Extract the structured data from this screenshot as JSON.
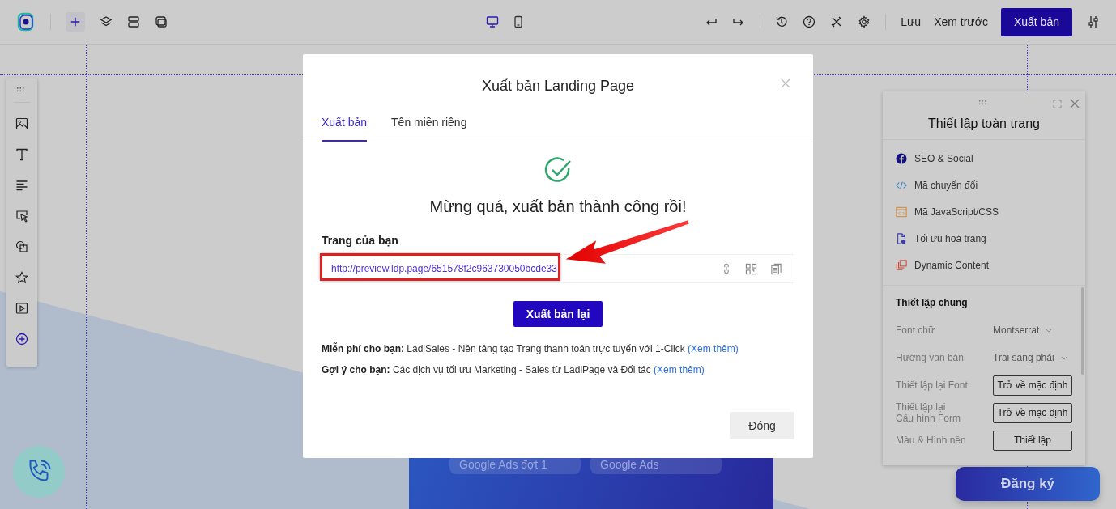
{
  "topbar": {
    "devices": [
      {
        "kind": "desktop",
        "selected": true
      },
      {
        "kind": "mobile",
        "selected": false
      }
    ],
    "links": [
      "Lưu",
      "Xem trước"
    ],
    "publish_button": "Xuất bản"
  },
  "canvas": {
    "form_fields": [
      {
        "placeholder": "Google Ads đợt 1"
      },
      {
        "placeholder": "Google Ads"
      }
    ],
    "cta_button": "Đăng ký"
  },
  "settings_panel": {
    "title": "Thiết lập toàn trang",
    "menu": [
      {
        "kind": "facebook",
        "label": "SEO & Social"
      },
      {
        "kind": "code",
        "label": "Mã chuyển đổi"
      },
      {
        "kind": "script",
        "label": "Mã JavaScript/CSS"
      },
      {
        "kind": "optimize",
        "label": "Tối ưu hoá trang"
      },
      {
        "kind": "dynamic",
        "label": "Dynamic Content"
      }
    ],
    "section_title": "Thiết lập chung",
    "settings": [
      {
        "kind": "select",
        "label": "Font chữ",
        "value": "Montserrat"
      },
      {
        "kind": "select",
        "label": "Hướng văn bản",
        "value": "Trái sang phải"
      },
      {
        "kind": "button",
        "label": "Thiết lập lại Font",
        "value": "Trở về mặc định"
      },
      {
        "kind": "button",
        "label": "Thiết lập lại\nCấu hình Form",
        "value": "Trở về mặc định"
      },
      {
        "kind": "button",
        "label": "Màu & Hình nền",
        "value": "Thiết lập"
      }
    ]
  },
  "modal": {
    "title": "Xuất bản Landing Page",
    "tabs": [
      {
        "label": "Xuất bản",
        "selected": true
      },
      {
        "label": "Tên miền riêng",
        "selected": false
      }
    ],
    "message": "Mừng quá, xuất bản thành công rồi!",
    "url_label": "Trang của bạn",
    "url": "http://preview.ldp.page/651578f2c963730050bcde33",
    "republish_button": "Xuất bản lại",
    "notes": [
      {
        "label": "Miễn phí cho bạn:",
        "text": "LadiSales - Nền tảng tạo Trang thanh toán trực tuyến với 1-Click",
        "link": "(Xem thêm)"
      },
      {
        "label": "Gợi ý cho bạn:",
        "text": "Các dịch vụ tối ưu Marketing - Sales từ LadiPage và Đối tác",
        "link": "(Xem thêm)"
      }
    ],
    "close_button": "Đóng"
  }
}
